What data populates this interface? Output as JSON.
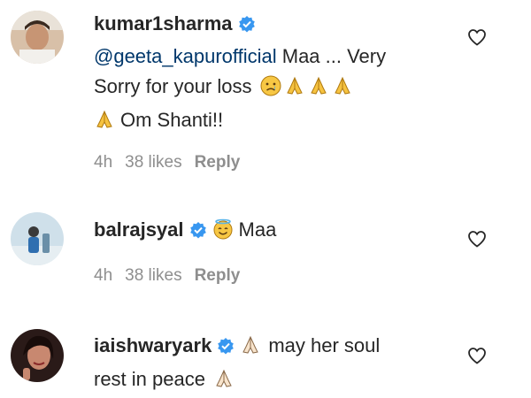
{
  "comments": [
    {
      "username": "kumar1sharma",
      "mention": "@geeta_kapurofficial",
      "text1": " Maa ... Very",
      "text2": "Sorry for your loss",
      "text3": "Om Shanti!!",
      "time": "4h",
      "likes": "38 likes",
      "reply": "Reply",
      "emojis": [
        "sad-face-icon",
        "folded-hands-icon"
      ]
    },
    {
      "username": "balrajsyal",
      "text1": "Maa",
      "time": "4h",
      "likes": "38 likes",
      "reply": "Reply",
      "emojis": [
        "smiling-face-with-halo-icon"
      ]
    },
    {
      "username": "iaishwaryark",
      "text1": "may her soul",
      "text2": "rest in peace",
      "emojis": [
        "folded-hands-icon"
      ]
    }
  ],
  "colors": {
    "text": "#262626",
    "mention": "#00376b",
    "meta": "#8e8e8e",
    "verified": "#3897f0"
  }
}
